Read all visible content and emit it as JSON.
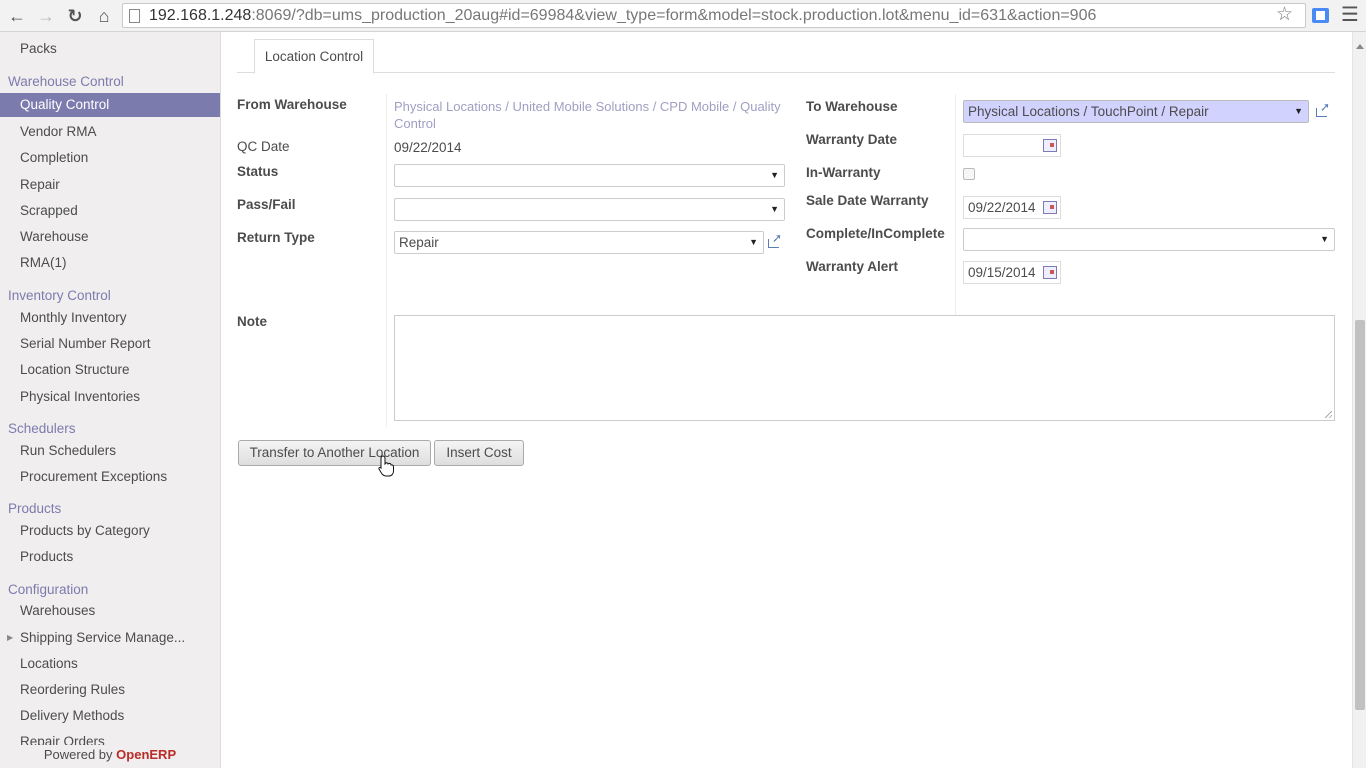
{
  "browser": {
    "url_host": "192.168.1.248",
    "url_rest": ":8069/?db=ums_production_20aug#id=69984&view_type=form&model=stock.production.lot&menu_id=631&action=906"
  },
  "sidebar": {
    "items": [
      {
        "label": "Packs",
        "type": "item"
      },
      {
        "label": "Warehouse Control",
        "type": "head"
      },
      {
        "label": "Quality Control",
        "type": "item",
        "active": true
      },
      {
        "label": "Vendor RMA",
        "type": "item"
      },
      {
        "label": "Completion",
        "type": "item"
      },
      {
        "label": "Repair",
        "type": "item"
      },
      {
        "label": "Scrapped",
        "type": "item"
      },
      {
        "label": "Warehouse",
        "type": "item"
      },
      {
        "label": "RMA(1)",
        "type": "item"
      },
      {
        "label": "Inventory Control",
        "type": "head"
      },
      {
        "label": "Monthly Inventory",
        "type": "item"
      },
      {
        "label": "Serial Number Report",
        "type": "item"
      },
      {
        "label": "Location Structure",
        "type": "item"
      },
      {
        "label": "Physical Inventories",
        "type": "item"
      },
      {
        "label": "Schedulers",
        "type": "head"
      },
      {
        "label": "Run Schedulers",
        "type": "item"
      },
      {
        "label": "Procurement Exceptions",
        "type": "item"
      },
      {
        "label": "Products",
        "type": "head"
      },
      {
        "label": "Products by Category",
        "type": "item"
      },
      {
        "label": "Products",
        "type": "item"
      },
      {
        "label": "Configuration",
        "type": "head"
      },
      {
        "label": "Warehouses",
        "type": "item"
      },
      {
        "label": "Shipping Service Manage...",
        "type": "item",
        "caret": true
      },
      {
        "label": "Locations",
        "type": "item"
      },
      {
        "label": "Reordering Rules",
        "type": "item"
      },
      {
        "label": "Delivery Methods",
        "type": "item"
      },
      {
        "label": "Repair Orders",
        "type": "item"
      }
    ],
    "powered_by": "Powered by",
    "brand": "OpenERP"
  },
  "tab": {
    "label": "Location Control"
  },
  "form": {
    "from_warehouse_label": "From Warehouse",
    "from_warehouse_value": "Physical Locations / United Mobile Solutions / CPD Mobile / Quality Control",
    "qc_date_label": "QC Date",
    "qc_date_value": "09/22/2014",
    "status_label": "Status",
    "status_value": "",
    "pass_fail_label": "Pass/Fail",
    "pass_fail_value": "",
    "return_type_label": "Return Type",
    "return_type_value": "Repair",
    "to_warehouse_label": "To Warehouse",
    "to_warehouse_value": "Physical Locations / TouchPoint / Repair",
    "warranty_date_label": "Warranty Date",
    "warranty_date_value": "",
    "in_warranty_label": "In-Warranty",
    "in_warranty_checked": false,
    "sale_date_warranty_label": "Sale Date Warranty",
    "sale_date_warranty_value": "09/22/2014",
    "complete_label": "Complete/InComplete",
    "complete_value": "",
    "warranty_alert_label": "Warranty Alert",
    "warranty_alert_value": "09/15/2014",
    "note_label": "Note",
    "note_value": ""
  },
  "actions": {
    "transfer_label": "Transfer to Another Location",
    "insert_cost_label": "Insert Cost"
  },
  "colors": {
    "accent": "#7c7bad",
    "highlight_field": "#d2d2ff",
    "brand": "#b92c28"
  }
}
